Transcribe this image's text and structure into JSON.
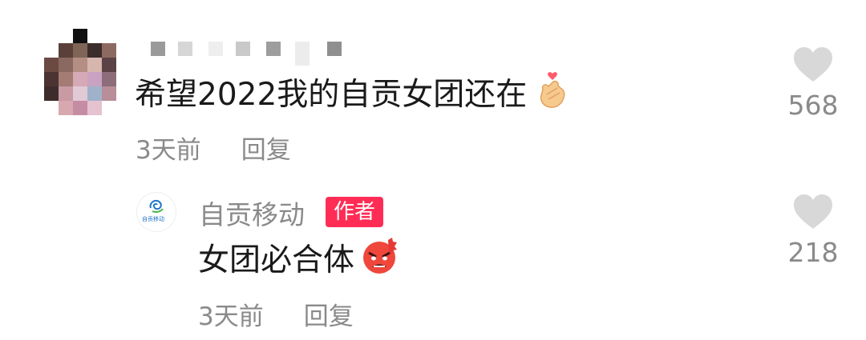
{
  "comment": {
    "text": "希望2022我的自贡女团还在",
    "emoji_icon": "finger-heart-emoji",
    "time": "3天前",
    "reply_label": "回复",
    "like_count": "568"
  },
  "reply": {
    "username": "自贡移动",
    "author_badge": "作者",
    "text": "女团必合体",
    "emoji_icon": "angry-face-emoji",
    "time": "3天前",
    "reply_label": "回复",
    "like_count": "218",
    "avatar_logo_text": "自贡移动"
  },
  "colors": {
    "text_primary": "#1a1a1a",
    "text_secondary": "#8a8a8a",
    "author_badge_bg": "#ff2d55",
    "heart": "#d8d8d8"
  }
}
